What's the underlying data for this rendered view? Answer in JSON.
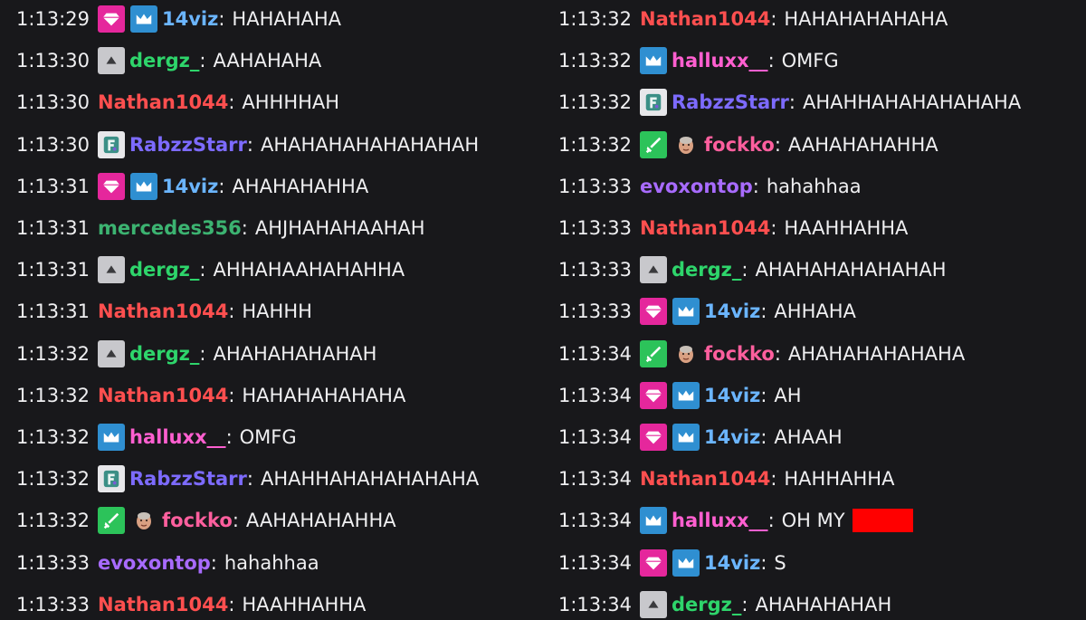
{
  "colors": {
    "background": "#18181b",
    "text": "#efeff1",
    "users": {
      "14viz": "#6bb5ff",
      "dergz_": "#2ed56b",
      "Nathan1044": "#ff4f4f",
      "RabzzStarr": "#7d6bff",
      "mercedes356": "#3cb371",
      "halluxx__": "#ff5fd0",
      "fockko": "#ff5f9e",
      "evoxontop": "#a86bff"
    },
    "redaction": "#ff0000"
  },
  "chat": {
    "left": [
      {
        "time": "1:13:29",
        "user": "14viz",
        "badges": [
          "gem-icon",
          "sub-crown-icon"
        ],
        "message": "HAHAHAHA"
      },
      {
        "time": "1:13:30",
        "user": "dergz_",
        "badges": [
          "arrow-up-icon"
        ],
        "message": "AAHAHAHA"
      },
      {
        "time": "1:13:30",
        "user": "Nathan1044",
        "badges": [],
        "message": "AHHHHAH"
      },
      {
        "time": "1:13:30",
        "user": "RabzzStarr",
        "badges": [
          "character-icon"
        ],
        "message": "AHAHAHAHAHAHAHAH"
      },
      {
        "time": "1:13:31",
        "user": "14viz",
        "badges": [
          "gem-icon",
          "sub-crown-icon"
        ],
        "message": "AHAHAHAHHA"
      },
      {
        "time": "1:13:31",
        "user": "mercedes356",
        "badges": [],
        "message": "AHJHAHAHAAHAH"
      },
      {
        "time": "1:13:31",
        "user": "dergz_",
        "badges": [
          "arrow-up-icon"
        ],
        "message": "AHHAHAAHAHAHHA"
      },
      {
        "time": "1:13:31",
        "user": "Nathan1044",
        "badges": [],
        "message": "HAHHH"
      },
      {
        "time": "1:13:32",
        "user": "dergz_",
        "badges": [
          "arrow-up-icon"
        ],
        "message": "AHAHAHAHAHAH"
      },
      {
        "time": "1:13:32",
        "user": "Nathan1044",
        "badges": [],
        "message": "HAHAHAHAHAHA"
      },
      {
        "time": "1:13:32",
        "user": "halluxx__",
        "badges": [
          "sub-crown-icon"
        ],
        "message": "OMFG"
      },
      {
        "time": "1:13:32",
        "user": "RabzzStarr",
        "badges": [
          "character-icon"
        ],
        "message": "AHAHHAHAHAHAHAHA"
      },
      {
        "time": "1:13:32",
        "user": "fockko",
        "badges": [
          "sword-icon",
          "face-emote-icon"
        ],
        "message": "AAHAHAHAHHA"
      },
      {
        "time": "1:13:33",
        "user": "evoxontop",
        "badges": [],
        "message": "hahahhaa"
      },
      {
        "time": "1:13:33",
        "user": "Nathan1044",
        "badges": [],
        "message": "HAAHHAHHA"
      }
    ],
    "right": [
      {
        "time": "1:13:32",
        "user": "Nathan1044",
        "badges": [],
        "message": "HAHAHAHAHAHA"
      },
      {
        "time": "1:13:32",
        "user": "halluxx__",
        "badges": [
          "sub-crown-icon"
        ],
        "message": "OMFG"
      },
      {
        "time": "1:13:32",
        "user": "RabzzStarr",
        "badges": [
          "character-icon"
        ],
        "message": "AHAHHAHAHAHAHAHA"
      },
      {
        "time": "1:13:32",
        "user": "fockko",
        "badges": [
          "sword-icon",
          "face-emote-icon"
        ],
        "message": "AAHAHAHAHHA"
      },
      {
        "time": "1:13:33",
        "user": "evoxontop",
        "badges": [],
        "message": "hahahhaa"
      },
      {
        "time": "1:13:33",
        "user": "Nathan1044",
        "badges": [],
        "message": "HAAHHAHHA"
      },
      {
        "time": "1:13:33",
        "user": "dergz_",
        "badges": [
          "arrow-up-icon"
        ],
        "message": "AHAHAHAHAHAHAH"
      },
      {
        "time": "1:13:33",
        "user": "14viz",
        "badges": [
          "gem-icon",
          "sub-crown-icon"
        ],
        "message": "AHHAHA"
      },
      {
        "time": "1:13:34",
        "user": "fockko",
        "badges": [
          "sword-icon",
          "face-emote-icon"
        ],
        "message": "AHAHAHAHAHAHA"
      },
      {
        "time": "1:13:34",
        "user": "14viz",
        "badges": [
          "gem-icon",
          "sub-crown-icon"
        ],
        "message": "AH"
      },
      {
        "time": "1:13:34",
        "user": "14viz",
        "badges": [
          "gem-icon",
          "sub-crown-icon"
        ],
        "message": "AHAAH"
      },
      {
        "time": "1:13:34",
        "user": "Nathan1044",
        "badges": [],
        "message": "HAHHAHHA"
      },
      {
        "time": "1:13:34",
        "user": "halluxx__",
        "badges": [
          "sub-crown-icon"
        ],
        "message": "OH MY",
        "redacted": true
      },
      {
        "time": "1:13:34",
        "user": "14viz",
        "badges": [
          "gem-icon",
          "sub-crown-icon"
        ],
        "message": "S"
      },
      {
        "time": "1:13:34",
        "user": "dergz_",
        "badges": [
          "arrow-up-icon"
        ],
        "message": "AHAHAHAHAH"
      }
    ]
  }
}
